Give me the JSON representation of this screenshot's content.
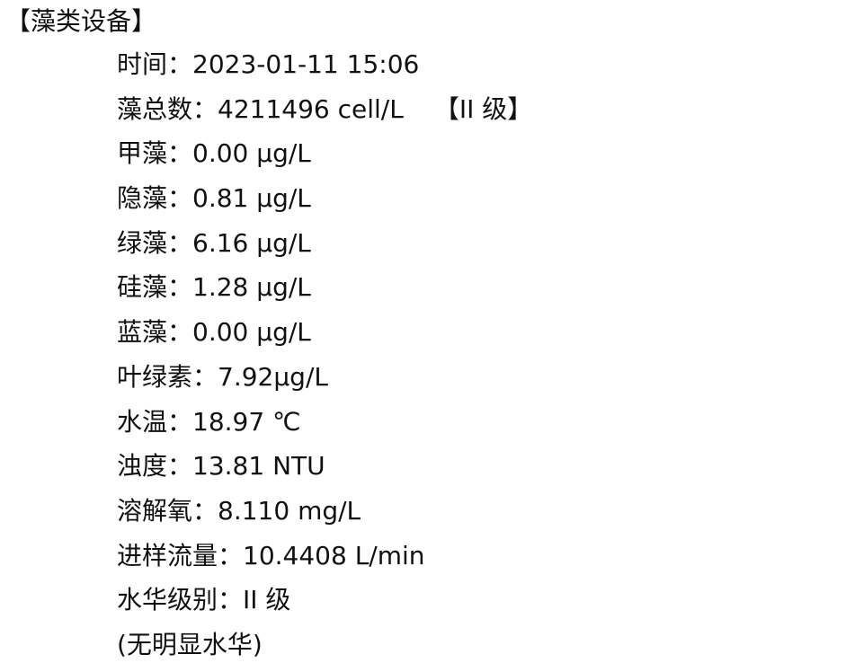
{
  "header": {
    "title": "【藻类设备】"
  },
  "rows": [
    {
      "label": "时间：",
      "value": "2023-01-11 15:06"
    },
    {
      "label": "藻总数：",
      "value": "4211496 cell/L",
      "grade": "【II 级】"
    },
    {
      "label": "甲藻：",
      "value": "0.00 μg/L"
    },
    {
      "label": "隐藻：",
      "value": "0.81 μg/L"
    },
    {
      "label": "绿藻：",
      "value": "6.16 μg/L"
    },
    {
      "label": "硅藻：",
      "value": "1.28 μg/L"
    },
    {
      "label": "蓝藻：",
      "value": "0.00 μg/L"
    },
    {
      "label": "叶绿素：",
      "value": "7.92μg/L"
    },
    {
      "label": "水温：",
      "value": "18.97 ℃"
    },
    {
      "label": "浊度：",
      "value": "13.81 NTU"
    },
    {
      "label": "溶解氧：",
      "value": "8.110 mg/L"
    },
    {
      "label": "进样流量：",
      "value": "10.4408 L/min"
    },
    {
      "label": "水华级别：",
      "value": "II 级"
    }
  ],
  "footer": {
    "note": "(无明显水华)"
  }
}
